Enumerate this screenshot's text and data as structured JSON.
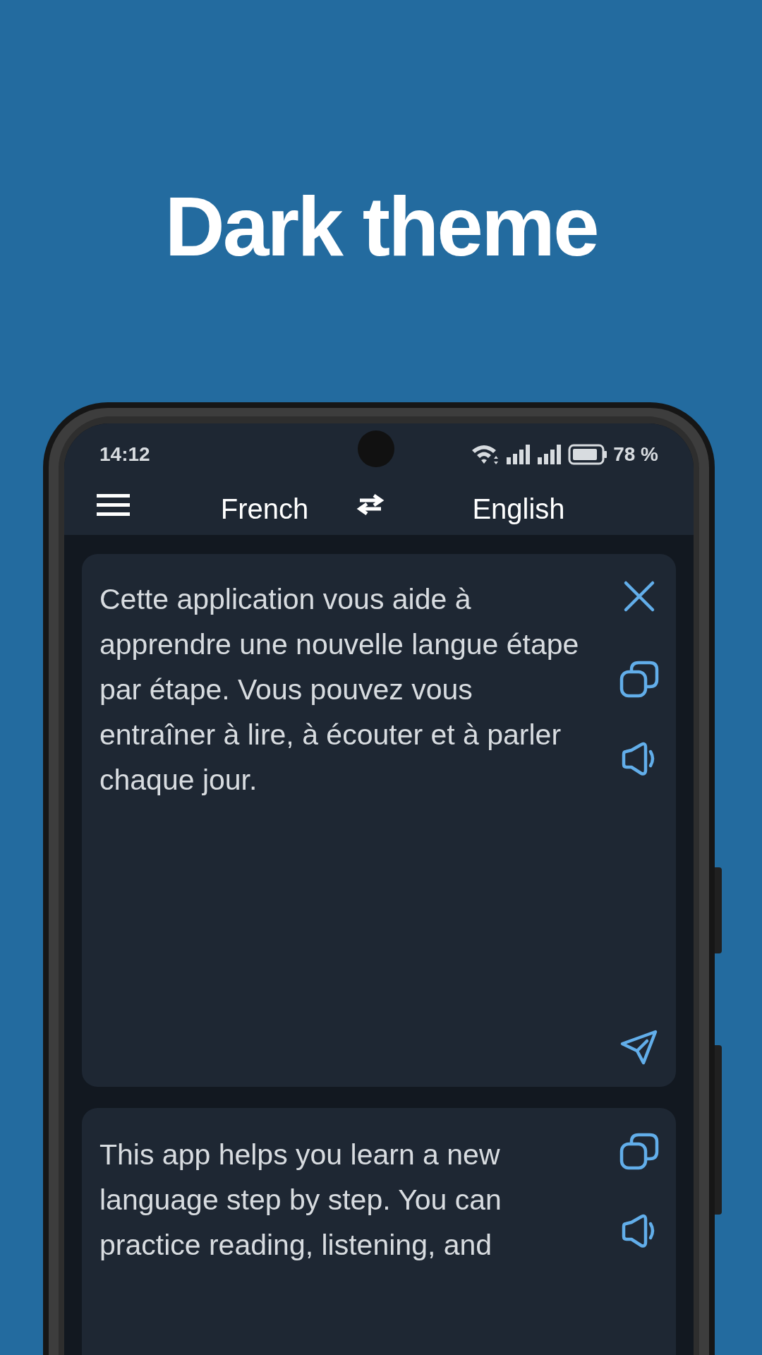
{
  "headline": "Dark theme",
  "status_bar": {
    "time": "14:12",
    "battery": "78 %"
  },
  "toolbar": {
    "source_language": "French",
    "target_language": "English"
  },
  "source_card": {
    "text": "Cette application vous aide à apprendre une nouvelle langue étape par étape. Vous pouvez vous entraîner à lire, à écouter et à parler chaque jour."
  },
  "result_card": {
    "text": "This app helps you learn a new language step by step. You can practice reading, listening, and"
  }
}
